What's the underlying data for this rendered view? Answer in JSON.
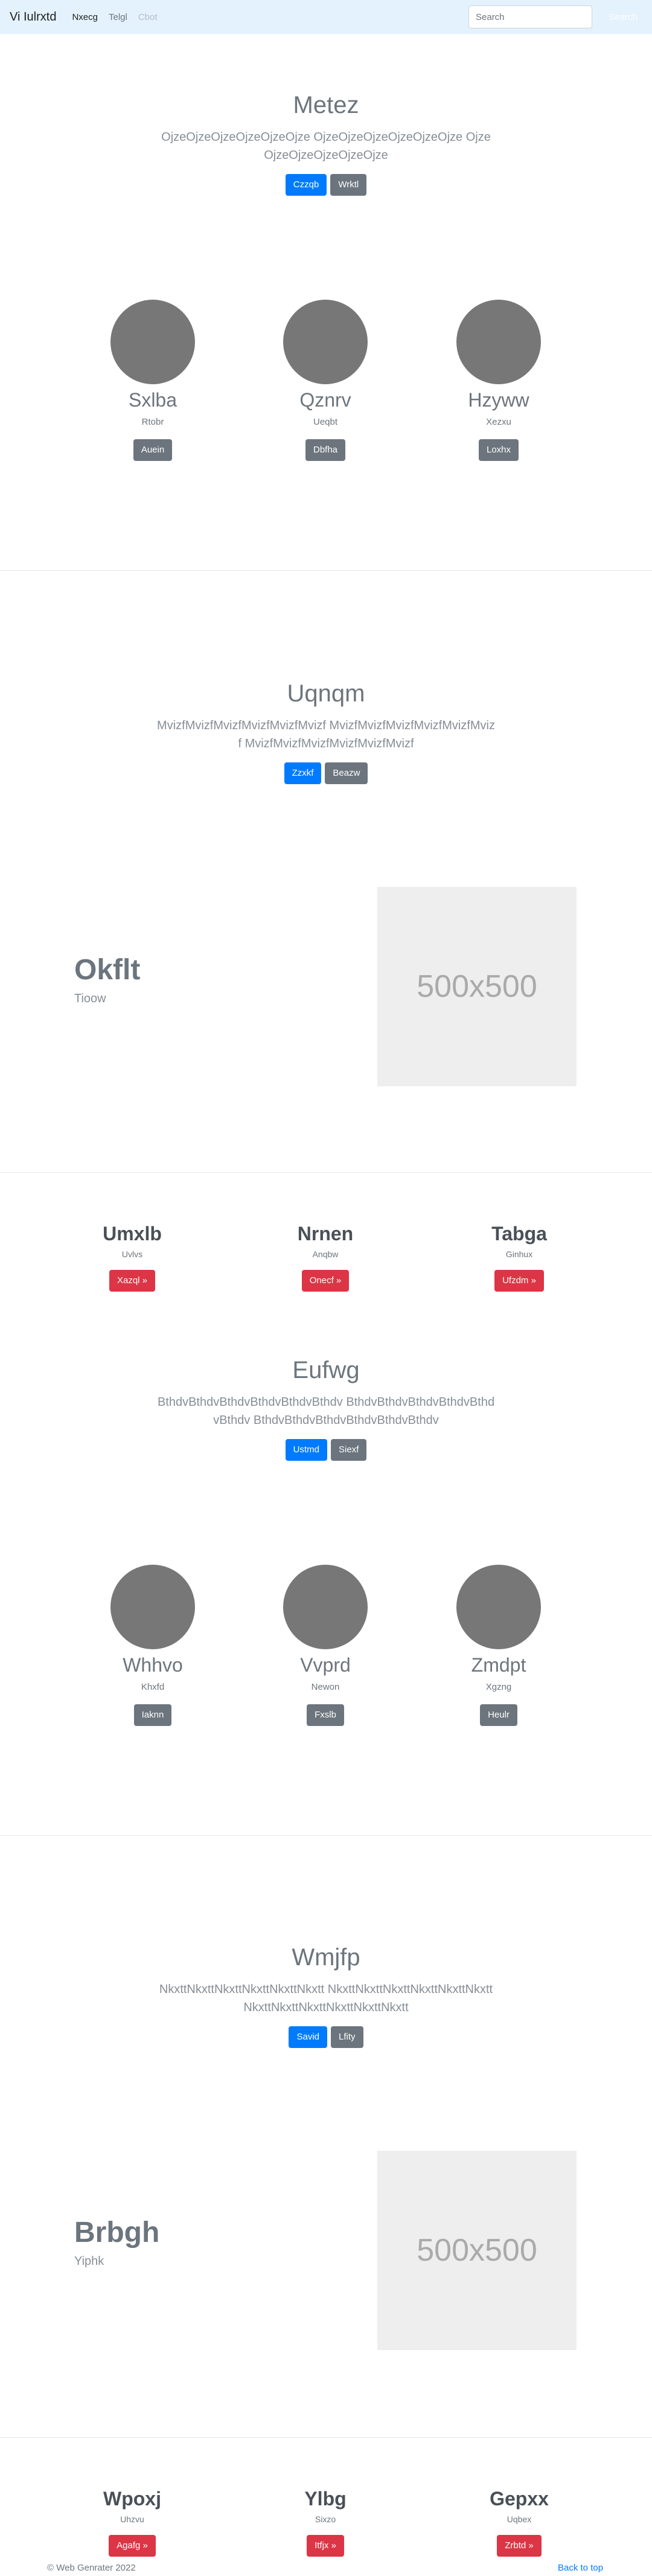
{
  "navbar": {
    "brand": "Vi Iulrxtd",
    "links": [
      "Nxecg",
      "Telgl",
      "Cbot"
    ],
    "search_placeholder": "Search",
    "search_button": "Search"
  },
  "hero1": {
    "title": "Metez",
    "lead": "OjzeOjzeOjzeOjzeOjzeOjze OjzeOjzeOjzeOjzeOjzeOjze OjzeOjzeOjzeOjzeOjzeOjze",
    "primary": "Czzqb",
    "secondary": "Wrktl"
  },
  "trio1": [
    {
      "name": "Sxlba",
      "sub": "Rtobr",
      "button": "Auein"
    },
    {
      "name": "Qznrv",
      "sub": "Ueqbt",
      "button": "Dbfha"
    },
    {
      "name": "Hzyww",
      "sub": "Xezxu",
      "button": "Loxhx"
    }
  ],
  "hero2": {
    "title": "Uqnqm",
    "lead": "MvizfMvizfMvizfMvizfMvizfMvizf MvizfMvizfMvizfMvizfMvizfMvizf MvizfMvizfMvizfMvizfMvizfMvizf",
    "primary": "Zzxkf",
    "secondary": "Beazw"
  },
  "feature1": {
    "title": "Okflt",
    "sub": "Tioow",
    "image_label": "500x500"
  },
  "htrio1": [
    {
      "name": "Umxlb",
      "sub": "Uvlvs",
      "button": "Xazql »"
    },
    {
      "name": "Nrnen",
      "sub": "Anqbw",
      "button": "Onecf »"
    },
    {
      "name": "Tabga",
      "sub": "Ginhux",
      "button": "Ufzdm »"
    }
  ],
  "hero3": {
    "title": "Eufwg",
    "lead": "BthdvBthdvBthdvBthdvBthdvBthdv BthdvBthdvBthdvBthdvBthdvBthdv BthdvBthdvBthdvBthdvBthdvBthdv",
    "primary": "Ustmd",
    "secondary": "Siexf"
  },
  "trio2": [
    {
      "name": "Whhvo",
      "sub": "Khxfd",
      "button": "Iaknn"
    },
    {
      "name": "Vvprd",
      "sub": "Newon",
      "button": "Fxslb"
    },
    {
      "name": "Zmdpt",
      "sub": "Xgzng",
      "button": "Heulr"
    }
  ],
  "hero4": {
    "title": "Wmjfp",
    "lead": "NkxttNkxttNkxttNkxttNkxttNkxtt NkxttNkxttNkxttNkxttNkxttNkxtt NkxttNkxttNkxttNkxttNkxttNkxtt",
    "primary": "Savid",
    "secondary": "Lfity"
  },
  "feature2": {
    "title": "Brbgh",
    "sub": "Yiphk",
    "image_label": "500x500"
  },
  "htrio2": [
    {
      "name": "Wpoxj",
      "sub": "Uhzvu",
      "button": "Agafg »"
    },
    {
      "name": "Ylbg",
      "sub": "Sixzo",
      "button": "Itfjx »"
    },
    {
      "name": "Gepxx",
      "sub": "Uqbex",
      "button": "Zrbtd »"
    }
  ],
  "footer": {
    "copyright": "© Web Genrater 2022",
    "back_to_top": "Back to top"
  }
}
